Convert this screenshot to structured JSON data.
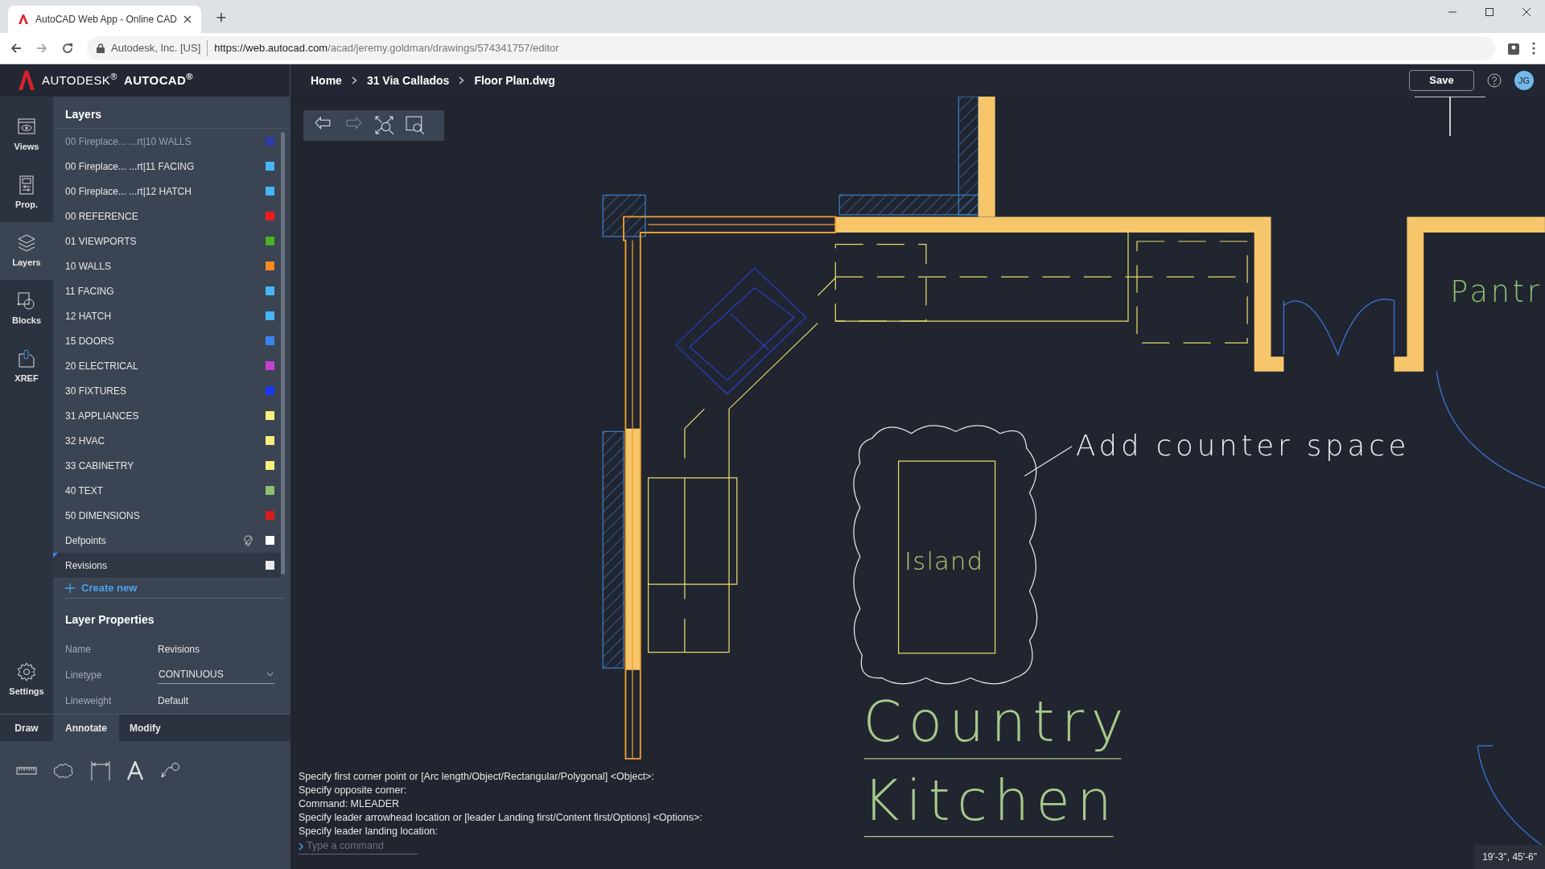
{
  "browser": {
    "tab_title": "AutoCAD Web App - Online CAD",
    "new_tab": "+",
    "site_identity": "Autodesk, Inc. [US]",
    "url_host": "https://web.autocad.com",
    "url_path": "/acad/jeremy.goldman/drawings/574341757/editor"
  },
  "header": {
    "brand": "AUTODESK$^{®}$",
    "product": "AUTOCAD$^{®}$",
    "breadcrumb": [
      "Home",
      "31 Via Callados",
      "Floor Plan.dwg"
    ],
    "save": "Save",
    "avatar": "JG"
  },
  "rail": [
    {
      "label": "Views",
      "kind": "views",
      "selected": false
    },
    {
      "label": "Prop.",
      "kind": "properties",
      "selected": false
    },
    {
      "label": "Layers",
      "kind": "layers",
      "selected": true
    },
    {
      "label": "Blocks",
      "kind": "blocks",
      "selected": false
    },
    {
      "label": "XREF",
      "kind": "xref",
      "selected": false
    },
    {
      "label": "Settings",
      "kind": "settings",
      "selected": false
    }
  ],
  "layers_panel": {
    "title": "Layers",
    "create_new": "Create new",
    "layers": [
      {
        "name": "00 Fireplace... ...rt|10 WALLS",
        "color": "#2d3ea8",
        "selected": false,
        "off": false
      },
      {
        "name": "00 Fireplace... ...rt|11 FACING",
        "color": "#45b5f5",
        "selected": false,
        "off": false
      },
      {
        "name": "00 Fireplace... ...rt|12 HATCH",
        "color": "#45b5f5",
        "selected": false,
        "off": false
      },
      {
        "name": "00 REFERENCE",
        "color": "#ee1c1c",
        "selected": false,
        "off": false
      },
      {
        "name": "01 VIEWPORTS",
        "color": "#4caf24",
        "selected": false,
        "off": false
      },
      {
        "name": "10 WALLS",
        "color": "#f58a1f",
        "selected": false,
        "off": false
      },
      {
        "name": "11 FACING",
        "color": "#45b5f5",
        "selected": false,
        "off": false
      },
      {
        "name": "12 HATCH",
        "color": "#45b5f5",
        "selected": false,
        "off": false
      },
      {
        "name": "15 DOORS",
        "color": "#3a86f0",
        "selected": false,
        "off": false
      },
      {
        "name": "20 ELECTRICAL",
        "color": "#c53fd0",
        "selected": false,
        "off": false
      },
      {
        "name": "30 FIXTURES",
        "color": "#1a3af5",
        "selected": false,
        "off": false
      },
      {
        "name": "31 APPLIANCES",
        "color": "#f8ee7e",
        "selected": false,
        "off": false
      },
      {
        "name": "32 HVAC",
        "color": "#f8ee7e",
        "selected": false,
        "off": false
      },
      {
        "name": "33 CABINETRY",
        "color": "#f8ee7e",
        "selected": false,
        "off": false
      },
      {
        "name": "40 TEXT",
        "color": "#8dc26f",
        "selected": false,
        "off": false
      },
      {
        "name": "50 DIMENSIONS",
        "color": "#d91c1c",
        "selected": false,
        "off": false
      },
      {
        "name": "Defpoints",
        "color": "#ffffff",
        "selected": false,
        "off": true
      },
      {
        "name": "Revisions",
        "color": "#e8e8e8",
        "selected": true,
        "off": false
      }
    ]
  },
  "layer_properties": {
    "title": "Layer Properties",
    "fields": [
      {
        "label": "Name",
        "value": "Revisions",
        "kind": "text"
      },
      {
        "label": "Linetype",
        "value": "CONTINUOUS",
        "kind": "dropdown"
      },
      {
        "label": "Lineweight",
        "value": "Default",
        "kind": "text"
      }
    ]
  },
  "tool_tabs": [
    {
      "label": "Draw",
      "selected": false
    },
    {
      "label": "Annotate",
      "selected": true
    },
    {
      "label": "Modify",
      "selected": false
    }
  ],
  "tools": [
    {
      "kind": "measure"
    },
    {
      "kind": "cloud"
    },
    {
      "kind": "dimension"
    },
    {
      "kind": "text"
    },
    {
      "kind": "leader"
    }
  ],
  "canvas_toolbar": [
    {
      "kind": "undo",
      "disabled": false
    },
    {
      "kind": "redo",
      "disabled": true
    },
    {
      "kind": "zoom-extents",
      "disabled": false
    },
    {
      "kind": "zoom-window",
      "disabled": false
    }
  ],
  "drawing": {
    "texts": [
      {
        "kind": "note",
        "text": "Add counter space"
      },
      {
        "kind": "island",
        "text": "Island"
      },
      {
        "kind": "title-1",
        "text": "Country"
      },
      {
        "kind": "title-2",
        "text": "Kitchen"
      },
      {
        "kind": "room",
        "text": "Pantr"
      }
    ]
  },
  "command_line": {
    "history": [
      "Specify first corner point or [Arc length/Object/Rectangular/Polygonal] <Object>:",
      "Specify opposite corner:",
      "Command: MLEADER",
      "Specify leader arrowhead location or [leader Landing first/Content first/Options] <Options>:",
      "Specify leader landing location:"
    ],
    "placeholder": "Type a command"
  },
  "coordinates": "19'-3\", 45'-6\""
}
